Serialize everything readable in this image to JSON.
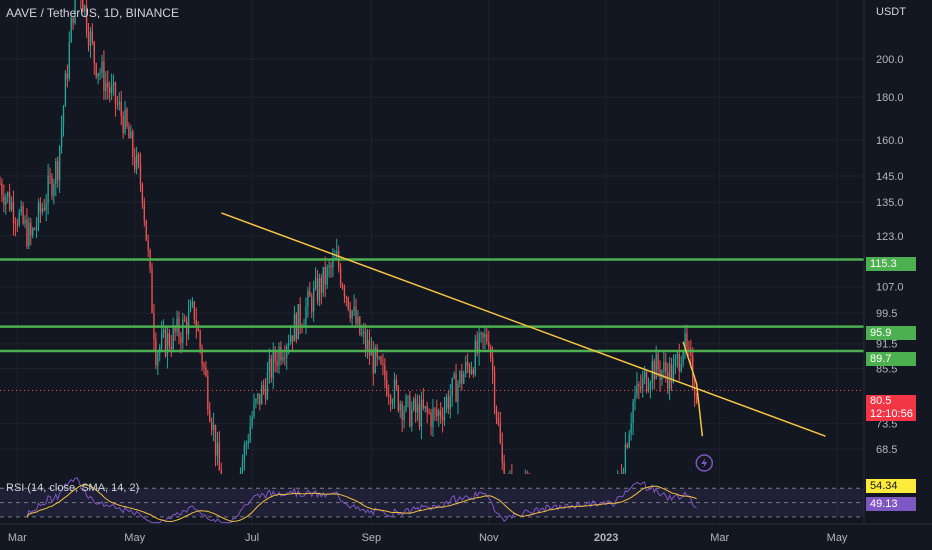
{
  "header": {
    "symbol_title": "AAVE / TetherUS, 1D, BINANCE",
    "price_unit": "USDT",
    "rsi_title": "RSI (14, close, SMA, 14, 2)"
  },
  "price_tags": {
    "level_1": "115.3",
    "level_2": "95.9",
    "level_3": "89.7",
    "last_price": "80.5",
    "countdown": "12:10:56",
    "rsi_value": "54.34",
    "rsi_ma_value": "49.13"
  },
  "colors": {
    "background": "#131722",
    "up": "#26a69a",
    "down": "#ef5350",
    "support_line": "#4caf50",
    "trend_line": "#f5c542",
    "rsi_line": "#7e57c2",
    "rsi_ma": "#f0c040",
    "last_price_tag": "#f23645",
    "rsi_tag": "#ffeb3b"
  },
  "icons": [
    "lightning-alert-icon"
  ],
  "chart_data": {
    "type": "candlestick",
    "y_axis": {
      "scale": "log",
      "ylim": [
        64,
        235
      ],
      "ticks": [
        68.5,
        73.5,
        85.5,
        91.5,
        99.5,
        107.0,
        123.0,
        135.0,
        145.0,
        160.0,
        180.0,
        200.0
      ]
    },
    "x_axis_ticks": [
      "Mar",
      "May",
      "Jul",
      "Sep",
      "Nov",
      "2023",
      "Mar",
      "May"
    ],
    "x_axis_dates": [
      "2022-03-01",
      "2022-05-01",
      "2022-07-01",
      "2022-09-01",
      "2022-11-01",
      "2023-01-01",
      "2023-03-01",
      "2023-05-01"
    ],
    "horizontal_levels": [
      115.3,
      95.9,
      89.7
    ],
    "last_price": 80.5,
    "trendline": {
      "from": {
        "date": "2022-06-15",
        "price": 131
      },
      "to": {
        "date": "2023-04-25",
        "price": 71
      }
    },
    "price_path_anchors": [
      {
        "date": "2022-02-20",
        "price": 142
      },
      {
        "date": "2022-03-08",
        "price": 122
      },
      {
        "date": "2022-03-22",
        "price": 150
      },
      {
        "date": "2022-04-01",
        "price": 255
      },
      {
        "date": "2022-04-10",
        "price": 200
      },
      {
        "date": "2022-04-25",
        "price": 170
      },
      {
        "date": "2022-05-05",
        "price": 140
      },
      {
        "date": "2022-05-12",
        "price": 90
      },
      {
        "date": "2022-05-25",
        "price": 95
      },
      {
        "date": "2022-06-01",
        "price": 100
      },
      {
        "date": "2022-06-10",
        "price": 75
      },
      {
        "date": "2022-06-18",
        "price": 55
      },
      {
        "date": "2022-07-01",
        "price": 75
      },
      {
        "date": "2022-07-15",
        "price": 90
      },
      {
        "date": "2022-07-28",
        "price": 100
      },
      {
        "date": "2022-08-14",
        "price": 115
      },
      {
        "date": "2022-08-25",
        "price": 95
      },
      {
        "date": "2022-09-05",
        "price": 85
      },
      {
        "date": "2022-09-20",
        "price": 76
      },
      {
        "date": "2022-10-05",
        "price": 75
      },
      {
        "date": "2022-10-20",
        "price": 85
      },
      {
        "date": "2022-11-01",
        "price": 94
      },
      {
        "date": "2022-11-09",
        "price": 62
      },
      {
        "date": "2022-12-10",
        "price": 58
      },
      {
        "date": "2023-01-05",
        "price": 58
      },
      {
        "date": "2023-01-15",
        "price": 78
      },
      {
        "date": "2023-01-25",
        "price": 86
      },
      {
        "date": "2023-02-05",
        "price": 84
      },
      {
        "date": "2023-02-10",
        "price": 92
      },
      {
        "date": "2023-02-17",
        "price": 80.5
      }
    ],
    "rsi": {
      "title": "RSI (14, close, SMA, 14, 2)",
      "value": 54.34,
      "ma_value": 49.13
    }
  }
}
